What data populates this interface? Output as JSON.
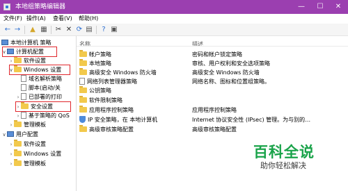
{
  "window": {
    "title": "本地组策略编辑器",
    "accent": "#9b3fb0"
  },
  "window_buttons": [
    "—",
    "☐",
    "✕"
  ],
  "menu": [
    "文件(F)",
    "操作(A)",
    "查看(V)",
    "帮助(H)"
  ],
  "toolbar": [
    "back-arrow-icon",
    "forward-arrow-icon",
    "folder-up-icon",
    "show-tree-icon",
    "cut-icon",
    "delete-icon",
    "refresh-icon",
    "export-icon",
    "help-icon",
    "properties-icon"
  ],
  "tree": {
    "root": "本地计算机 策略",
    "computer_config": "计算机配置",
    "software_settings": "软件设置",
    "windows_settings": "Windows 设置",
    "dns": "域名解析策略",
    "scripts": "脚本(启动/关",
    "printers": "已部署的打印",
    "security": "安全设置",
    "qos": "基于策略的 QoS",
    "admin_templates": "管理模板",
    "user_config": "用户配置",
    "u_software": "软件设置",
    "u_windows": "Windows 设置",
    "u_admin": "管理模板"
  },
  "list": {
    "col_name": "名称",
    "col_desc": "描述",
    "rows": [
      {
        "name": "帐户策略",
        "desc": "密码和帐户锁定策略",
        "icon": "folder"
      },
      {
        "name": "本地策略",
        "desc": "审核、用户权利和安全选项策略",
        "icon": "folder"
      },
      {
        "name": "高级安全 Windows 防火墙",
        "desc": "高级安全 Windows 防火墙",
        "icon": "folder"
      },
      {
        "name": "网络列表管理器策略",
        "desc": "网络名称、图标和位置组策略。",
        "icon": "doc"
      },
      {
        "name": "公钥策略",
        "desc": "",
        "icon": "folder"
      },
      {
        "name": "软件限制策略",
        "desc": "",
        "icon": "folder"
      },
      {
        "name": "应用程序控制策略",
        "desc": "应用程序控制策略",
        "icon": "folder"
      },
      {
        "name": "IP 安全策略，在 本地计算机",
        "desc": "Internet 协议安全性 (IPsec) 管理。为与别的…",
        "icon": "shield"
      },
      {
        "name": "高级审核策略配置",
        "desc": "高级审核策略配置",
        "icon": "folder"
      }
    ]
  },
  "watermark": {
    "main": "百科全说",
    "sub": "助你轻松解决",
    "color": "#1aa34a"
  }
}
